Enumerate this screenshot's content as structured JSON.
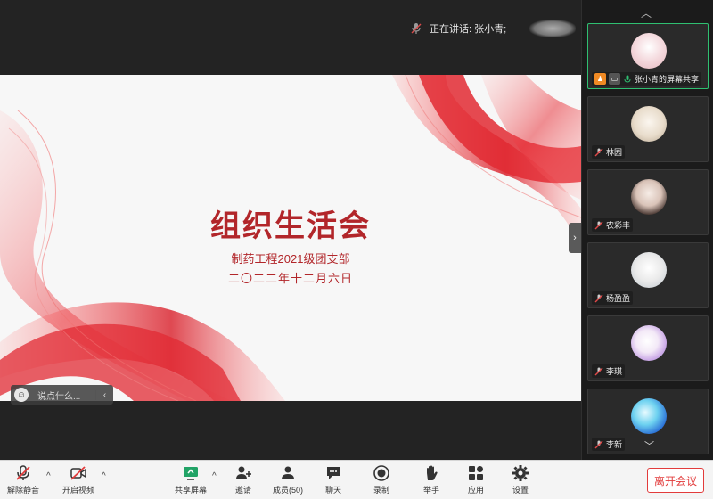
{
  "header": {
    "speaking_label": "正在讲话: 张小青;"
  },
  "slide": {
    "title": "组织生活会",
    "subtitle": "制药工程2021级团支部",
    "date": "二〇二二年十二月六日",
    "accent_color": "#b2262a"
  },
  "chat": {
    "placeholder": "说点什么..."
  },
  "participants": [
    {
      "name": "张小青的屏幕共享",
      "avatar": "pink-avatar",
      "sharing": true
    },
    {
      "name": "林园",
      "avatar": "plush-toy-avatar"
    },
    {
      "name": "农彩丰",
      "avatar": "girl-photo-avatar"
    },
    {
      "name": "杨盈盈",
      "avatar": "doll-avatar"
    },
    {
      "name": "李琪",
      "avatar": "cartoon-avatar"
    },
    {
      "name": "李新",
      "avatar": "blue-bubble-avatar"
    }
  ],
  "toolbar": {
    "unmute": "解除静音",
    "start_video": "开启视频",
    "share_screen": "共享屏幕",
    "invite": "邀请",
    "members": "成员(50)",
    "chat": "聊天",
    "record": "录制",
    "raise_hand": "举手",
    "apps": "应用",
    "settings": "设置",
    "leave": "离开会议"
  },
  "colors": {
    "leave_red": "#e23b3b",
    "active_green": "#2fbf71"
  }
}
